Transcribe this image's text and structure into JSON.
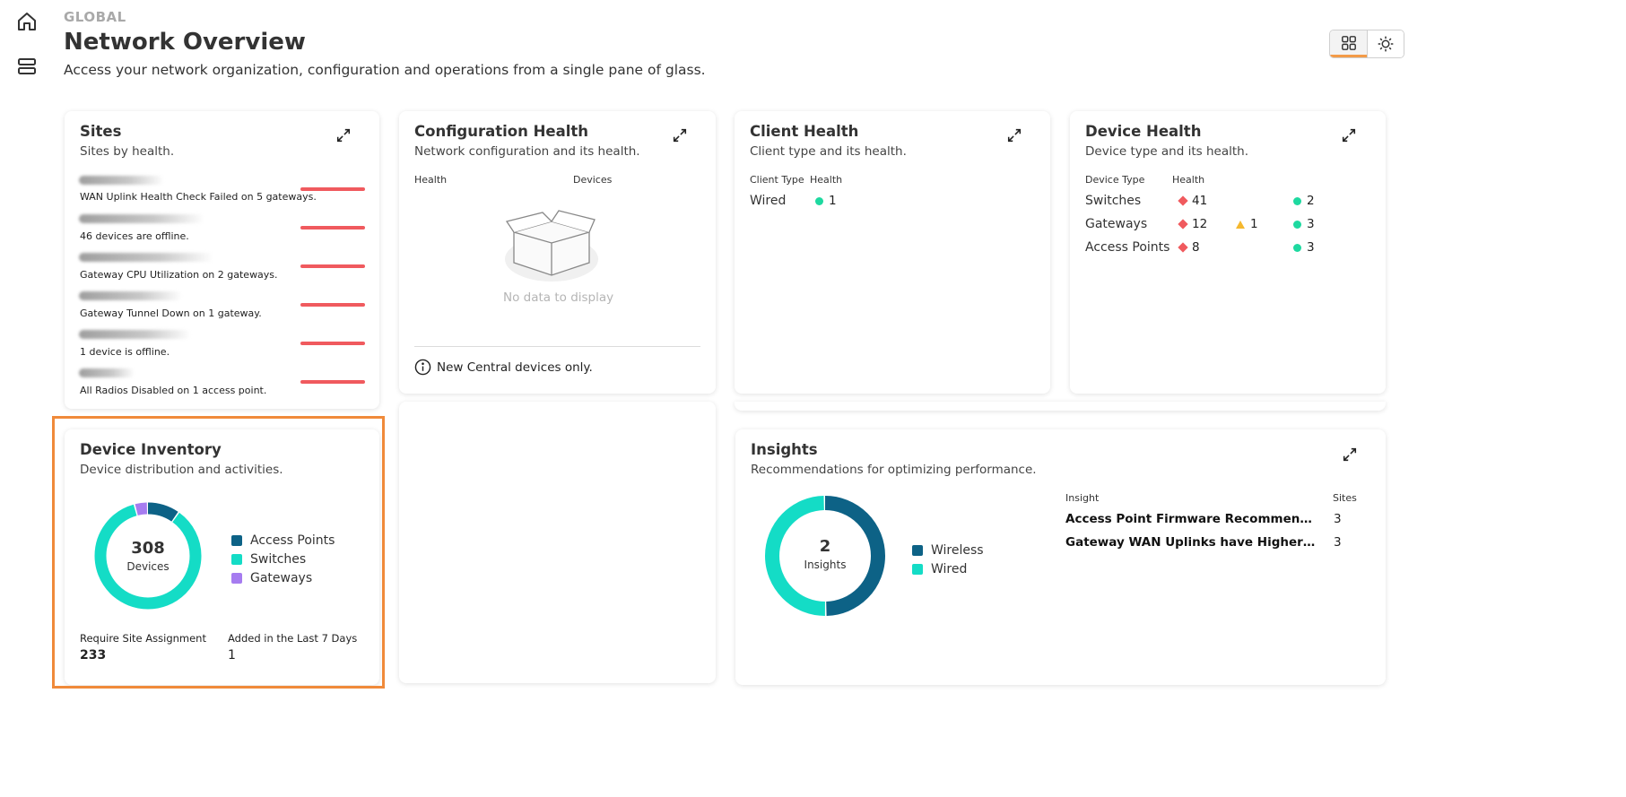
{
  "header": {
    "scope": "GLOBAL",
    "title": "Network Overview",
    "subtitle": "Access your network organization, configuration and operations from a single pane of glass."
  },
  "sites": {
    "title": "Sites",
    "subtitle": "Sites by health.",
    "items": [
      {
        "issue": "WAN Uplink Health Check Failed on 5 gateways."
      },
      {
        "issue": "46 devices are offline."
      },
      {
        "issue": "Gateway CPU Utilization on 2 gateways."
      },
      {
        "issue": "Gateway Tunnel Down on 1 gateway."
      },
      {
        "issue": "1 device is offline."
      },
      {
        "issue": "All Radios Disabled on 1 access point."
      }
    ]
  },
  "config_health": {
    "title": "Configuration Health",
    "subtitle": "Network configuration and its health.",
    "col_health": "Health",
    "col_devices": "Devices",
    "empty": "No data to display",
    "note": "New Central devices only."
  },
  "client_health": {
    "title": "Client Health",
    "subtitle": "Client type and its health.",
    "col_type": "Client Type",
    "col_health": "Health",
    "rows": [
      {
        "type": "Wired",
        "good": "1"
      }
    ]
  },
  "device_health": {
    "title": "Device Health",
    "subtitle": "Device type and its health.",
    "col_type": "Device Type",
    "col_health": "Health",
    "rows": [
      {
        "type": "Switches",
        "critical": "41",
        "warning": "",
        "good": "2"
      },
      {
        "type": "Gateways",
        "critical": "12",
        "warning": "1",
        "good": "3"
      },
      {
        "type": "Access Points",
        "critical": "8",
        "warning": "",
        "good": "3"
      }
    ],
    "colors": {
      "critical": "#f05a5e",
      "warning": "#f5b82e",
      "good": "#1ed9a0"
    }
  },
  "device_inventory": {
    "title": "Device Inventory",
    "subtitle": "Device distribution and activities.",
    "total": "308",
    "total_label": "Devices",
    "legend": [
      {
        "name": "Access Points",
        "color": "#0d6286"
      },
      {
        "name": "Switches",
        "color": "#14dcc6"
      },
      {
        "name": "Gateways",
        "color": "#a67cf0"
      }
    ],
    "segments": [
      {
        "name": "Access Points",
        "fraction": 0.1
      },
      {
        "name": "Switches",
        "fraction": 0.86
      },
      {
        "name": "Gateways",
        "fraction": 0.04
      }
    ],
    "metric1_label": "Require Site Assignment",
    "metric1_value": "233",
    "metric2_label": "Added in the Last 7 Days",
    "metric2_value": "1"
  },
  "insights": {
    "title": "Insights",
    "subtitle": "Recommendations for optimizing performance.",
    "total": "2",
    "total_label": "Insights",
    "legend": [
      {
        "name": "Wireless",
        "color": "#0d6286"
      },
      {
        "name": "Wired",
        "color": "#14dcc6"
      }
    ],
    "segments": [
      {
        "name": "Wireless",
        "fraction": 0.5
      },
      {
        "name": "Wired",
        "fraction": 0.5
      }
    ],
    "col_insight": "Insight",
    "col_sites": "Sites",
    "rows": [
      {
        "name": "Access Point Firmware Recommendation",
        "sites": "3"
      },
      {
        "name": "Gateway WAN Uplinks have Higher Latency",
        "sites": "3"
      }
    ]
  }
}
